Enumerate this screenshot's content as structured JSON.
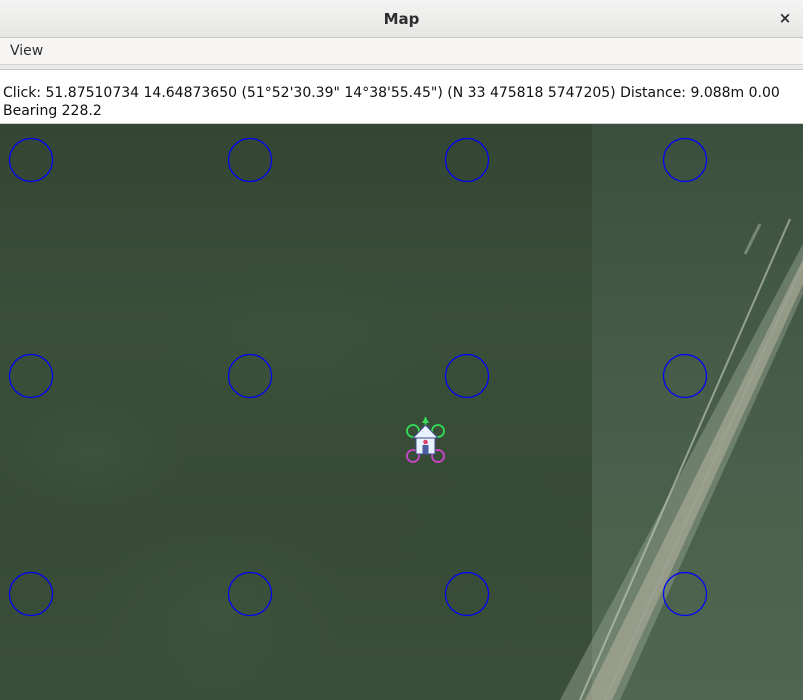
{
  "window": {
    "title": "Map",
    "close_glyph": "×"
  },
  "menu": {
    "items": [
      "View"
    ]
  },
  "info": {
    "line1": "Click: 51.87510734 14.64873650 (51°52'30.39\" 14°38'55.45\") (N 33 475818 5747205)  Distance: 9.088m 0.00",
    "line2": "Bearing 228.2"
  },
  "map": {
    "grid_rows": 3,
    "grid_cols": 4,
    "marker_color": "#0000ff",
    "icons": [
      "waypoint-circle-icon",
      "home-icon",
      "vehicle-icon"
    ]
  },
  "colors": {
    "titlebar": "#e6e6e4",
    "vehicle_front": "#33dd55",
    "vehicle_rear": "#cc44cc",
    "home": "#e8f2ff"
  }
}
